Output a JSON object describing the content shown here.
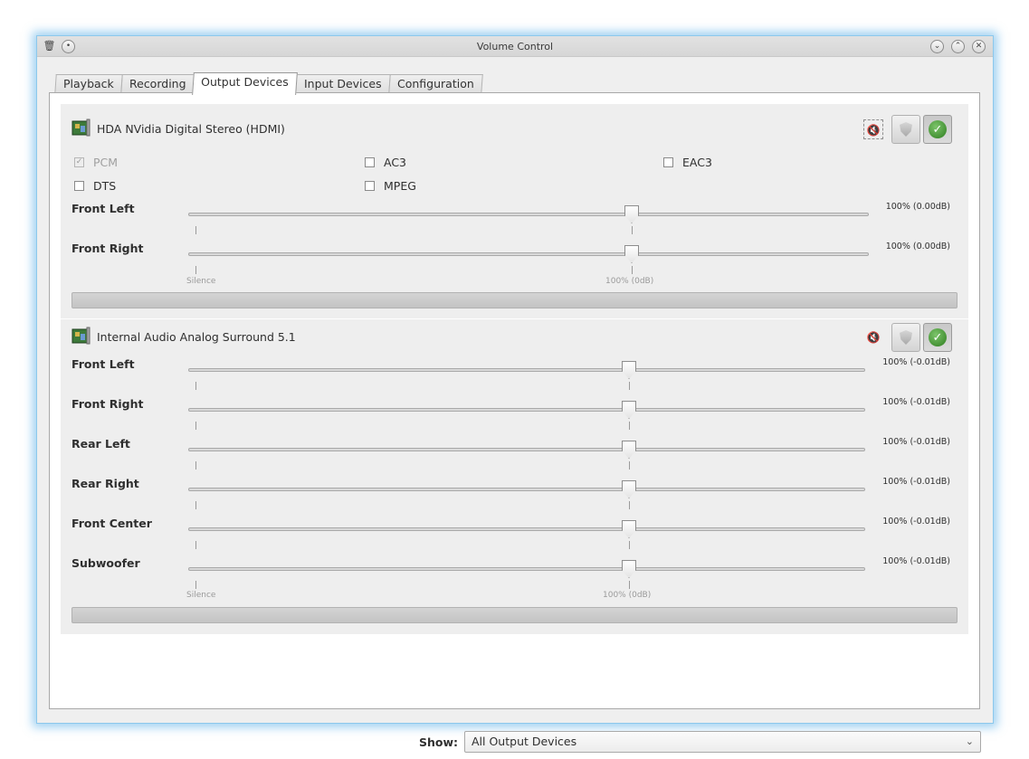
{
  "window": {
    "title": "Volume Control"
  },
  "titlebar_buttons": {
    "left": [
      "app-menu",
      "sticky"
    ],
    "right": [
      "minimize",
      "maximize",
      "close"
    ]
  },
  "tabs": [
    {
      "label": "Playback",
      "active": false
    },
    {
      "label": "Recording",
      "active": false
    },
    {
      "label": "Output Devices",
      "active": true
    },
    {
      "label": "Input Devices",
      "active": false
    },
    {
      "label": "Configuration",
      "active": false
    }
  ],
  "devices": [
    {
      "name": "HDA NVidia Digital Stereo (HDMI)",
      "icon": "sound-card-icon",
      "formats": [
        {
          "label": "PCM",
          "checked": true,
          "enabled": false
        },
        {
          "label": "AC3",
          "checked": false,
          "enabled": true
        },
        {
          "label": "EAC3",
          "checked": false,
          "enabled": true
        },
        {
          "label": "DTS",
          "checked": false,
          "enabled": true
        },
        {
          "label": "MPEG",
          "checked": false,
          "enabled": true
        }
      ],
      "channels": [
        {
          "label": "Front Left",
          "value": "100% (0.00dB)",
          "level_percent": 100
        },
        {
          "label": "Front Right",
          "value": "100% (0.00dB)",
          "level_percent": 100
        }
      ],
      "scale_marks": {
        "min": "Silence",
        "norm": "100% (0dB)"
      },
      "mute": false,
      "lock_channels": true,
      "default": true
    },
    {
      "name": "Internal Audio Analog Surround 5.1",
      "icon": "sound-card-icon",
      "channels": [
        {
          "label": "Front Left",
          "value": "100% (-0.01dB)",
          "level_percent": 100
        },
        {
          "label": "Front Right",
          "value": "100% (-0.01dB)",
          "level_percent": 100
        },
        {
          "label": "Rear Left",
          "value": "100% (-0.01dB)",
          "level_percent": 100
        },
        {
          "label": "Rear Right",
          "value": "100% (-0.01dB)",
          "level_percent": 100
        },
        {
          "label": "Front Center",
          "value": "100% (-0.01dB)",
          "level_percent": 100
        },
        {
          "label": "Subwoofer",
          "value": "100% (-0.01dB)",
          "level_percent": 100
        }
      ],
      "scale_marks": {
        "min": "Silence",
        "norm": "100% (0dB)"
      },
      "mute": false,
      "lock_channels": true,
      "default": true
    }
  ],
  "show": {
    "label": "Show:",
    "selected": "All Output Devices"
  }
}
